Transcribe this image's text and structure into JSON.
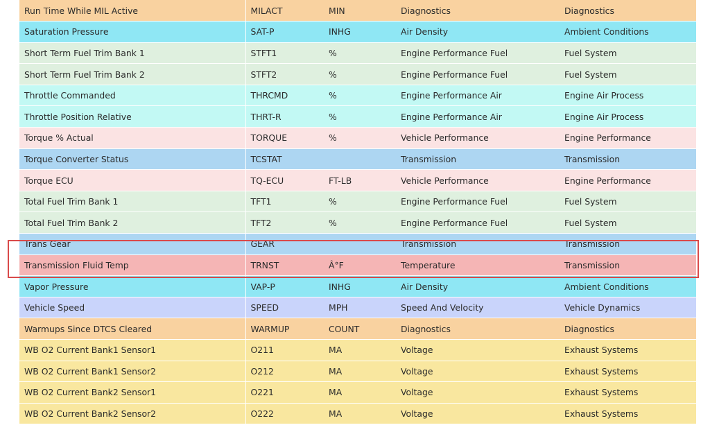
{
  "colors": {
    "Diagnostics": "#f9d2a0",
    "Ambient Conditions": "#8fe7f4",
    "Fuel System": "#dff0df",
    "Engine Air Process": "#c2f9f4",
    "Engine Performance": "#fbe3e3",
    "Transmission": "#add6f2",
    "Temperature": "#f5b5b5",
    "Vehicle Dynamics": "#c9d4fb",
    "Exhaust Systems": "#f9e79f",
    "highlight_border": "#d94a4a"
  },
  "rows": [
    {
      "name": "Run Time While MIL Active",
      "code": "MILACT",
      "unit": "MIN",
      "category": "Diagnostics",
      "group": "Diagnostics",
      "tone": "k-diag"
    },
    {
      "name": "Saturation Pressure",
      "code": "SAT-P",
      "unit": "INHG",
      "category": "Air Density",
      "group": "Ambient Conditions",
      "tone": "k-amb"
    },
    {
      "name": "Short Term Fuel Trim Bank 1",
      "code": "STFT1",
      "unit": "%",
      "category": "Engine Performance Fuel",
      "group": "Fuel System",
      "tone": "k-fuel"
    },
    {
      "name": "Short Term Fuel Trim Bank 2",
      "code": "STFT2",
      "unit": "%",
      "category": "Engine Performance Fuel",
      "group": "Fuel System",
      "tone": "k-fuel"
    },
    {
      "name": "Throttle Commanded",
      "code": "THRCMD",
      "unit": "%",
      "category": "Engine Performance Air",
      "group": "Engine Air Process",
      "tone": "k-air"
    },
    {
      "name": "Throttle Position Relative",
      "code": "THRT-R",
      "unit": "%",
      "category": "Engine Performance Air",
      "group": "Engine Air Process",
      "tone": "k-air"
    },
    {
      "name": "Torque % Actual",
      "code": "TORQUE",
      "unit": "%",
      "category": "Vehicle Performance",
      "group": "Engine Performance",
      "tone": "k-perf"
    },
    {
      "name": "Torque Converter Status",
      "code": "TCSTAT",
      "unit": "",
      "category": "Transmission",
      "group": "Transmission",
      "tone": "k-trans"
    },
    {
      "name": "Torque ECU",
      "code": "TQ-ECU",
      "unit": "FT-LB",
      "category": "Vehicle Performance",
      "group": "Engine Performance",
      "tone": "k-perf"
    },
    {
      "name": "Total Fuel Trim Bank 1",
      "code": "TFT1",
      "unit": "%",
      "category": "Engine Performance Fuel",
      "group": "Fuel System",
      "tone": "k-fuel"
    },
    {
      "name": "Total Fuel Trim Bank 2",
      "code": "TFT2",
      "unit": "%",
      "category": "Engine Performance Fuel",
      "group": "Fuel System",
      "tone": "k-fuel"
    },
    {
      "name": "Trans Gear",
      "code": "GEAR",
      "unit": "",
      "category": "Transmission",
      "group": "Transmission",
      "tone": "k-trans"
    },
    {
      "name": "Transmission Fluid Temp",
      "code": "TRNST",
      "unit": "Â°F",
      "category": "Temperature",
      "group": "Transmission",
      "tone": "k-temp"
    },
    {
      "name": "Vapor Pressure",
      "code": "VAP-P",
      "unit": "INHG",
      "category": "Air Density",
      "group": "Ambient Conditions",
      "tone": "k-amb"
    },
    {
      "name": "Vehicle Speed",
      "code": "SPEED",
      "unit": "MPH",
      "category": "Speed And Velocity",
      "group": "Vehicle Dynamics",
      "tone": "k-speed"
    },
    {
      "name": "Warmups Since DTCS Cleared",
      "code": "WARMUP",
      "unit": "COUNT",
      "category": "Diagnostics",
      "group": "Diagnostics",
      "tone": "k-diag"
    },
    {
      "name": "WB O2 Current Bank1 Sensor1",
      "code": "O211",
      "unit": "MA",
      "category": "Voltage",
      "group": "Exhaust Systems",
      "tone": "k-volt"
    },
    {
      "name": "WB O2 Current Bank1 Sensor2",
      "code": "O212",
      "unit": "MA",
      "category": "Voltage",
      "group": "Exhaust Systems",
      "tone": "k-volt"
    },
    {
      "name": "WB O2 Current Bank2 Sensor1",
      "code": "O221",
      "unit": "MA",
      "category": "Voltage",
      "group": "Exhaust Systems",
      "tone": "k-volt"
    },
    {
      "name": "WB O2 Current Bank2 Sensor2",
      "code": "O222",
      "unit": "MA",
      "category": "Voltage",
      "group": "Exhaust Systems",
      "tone": "k-volt"
    }
  ],
  "highlighted_row_index": 12
}
